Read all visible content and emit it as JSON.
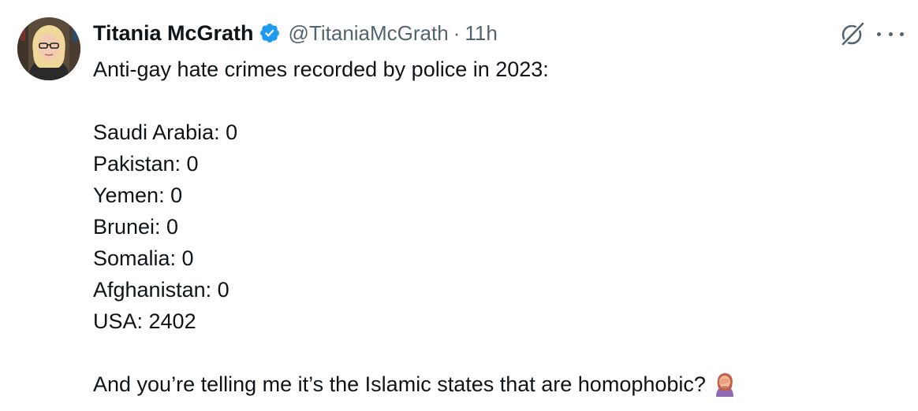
{
  "author": {
    "display_name": "Titania McGrath",
    "handle": "@TitaniaMcGrath",
    "separator": "·",
    "timestamp": "11h",
    "verified": true,
    "verified_color": "#1d9bf0"
  },
  "tweet": {
    "headline": "Anti-gay hate crimes recorded by police in 2023:",
    "list": [
      "Saudi Arabia: 0",
      "Pakistan: 0",
      "Yemen: 0",
      "Brunei: 0",
      "Somalia: 0",
      "Afghanistan: 0",
      "USA: 2402"
    ],
    "closing": "And you’re telling me it’s the Islamic states that are homophobic?",
    "closing_emoji": "facepalm-emoji"
  },
  "icons": {
    "grok": "grok-icon",
    "more": "more-options-icon",
    "verified": "verified-badge-icon"
  },
  "colors": {
    "text": "#0f1419",
    "secondary": "#536471",
    "accent": "#1d9bf0"
  }
}
